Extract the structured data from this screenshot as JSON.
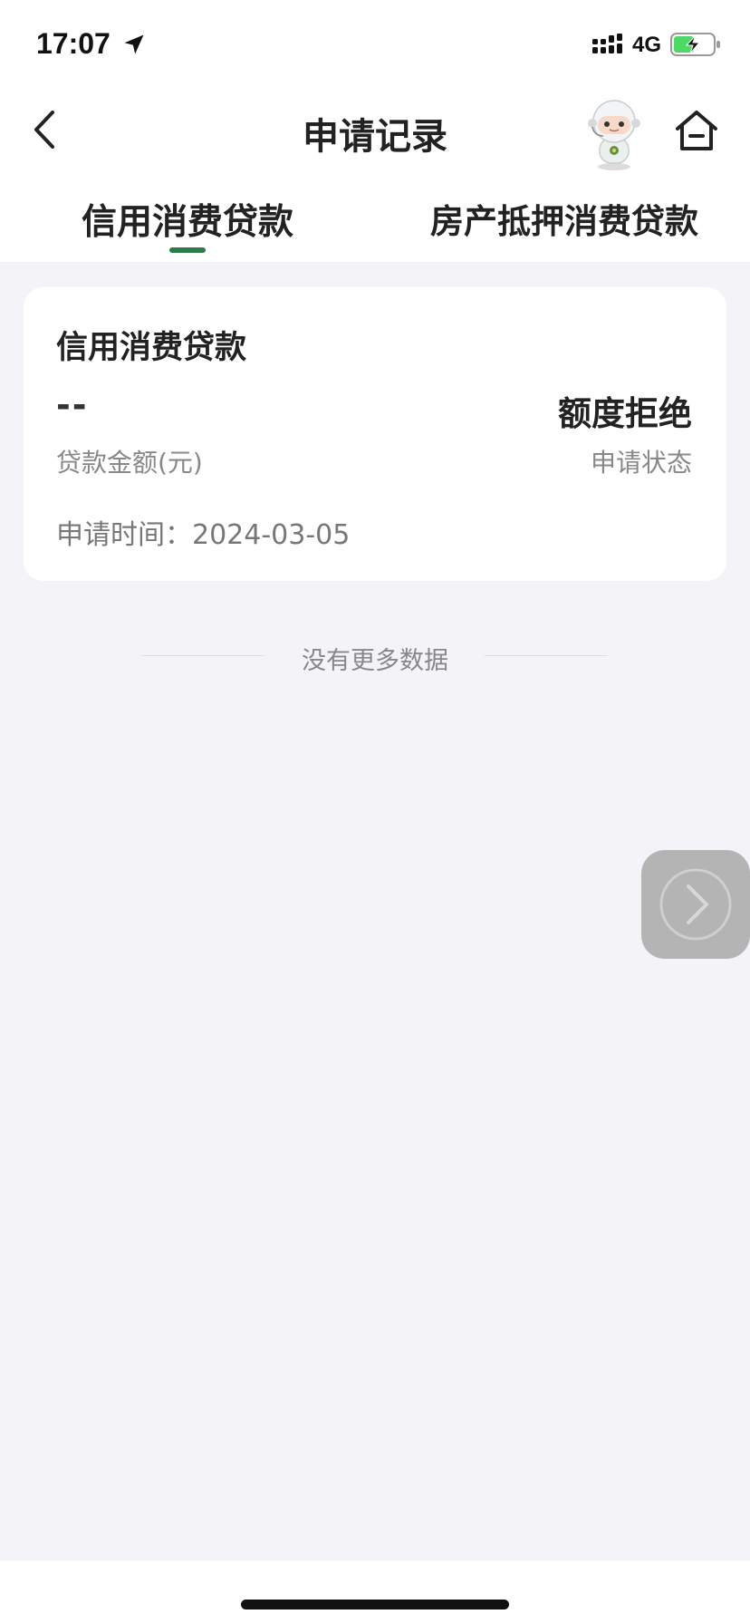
{
  "status_bar": {
    "time": "17:07",
    "network": "4G",
    "icons": [
      "location-arrow-icon",
      "signal-icon",
      "battery-charging-icon"
    ],
    "battery_color": "#4cd964"
  },
  "header": {
    "title": "申请记录",
    "icons": [
      "back-chevron-icon",
      "robot-mascot-icon",
      "home-icon"
    ]
  },
  "tabs": [
    {
      "label": "信用消费贷款",
      "selected": true
    },
    {
      "label": "房产抵押消费贷款",
      "selected": false
    }
  ],
  "accent_color": "#2e7a4b",
  "record": {
    "product": "信用消费贷款",
    "amount_value": "--",
    "amount_label": "贷款金额(元)",
    "status_value": "额度拒绝",
    "status_label": "申请状态",
    "date_label": "申请时间：",
    "date_value": "2024-03-05"
  },
  "list_end_text": "没有更多数据",
  "floating_button": {
    "icon": "chevron-right-icon"
  }
}
